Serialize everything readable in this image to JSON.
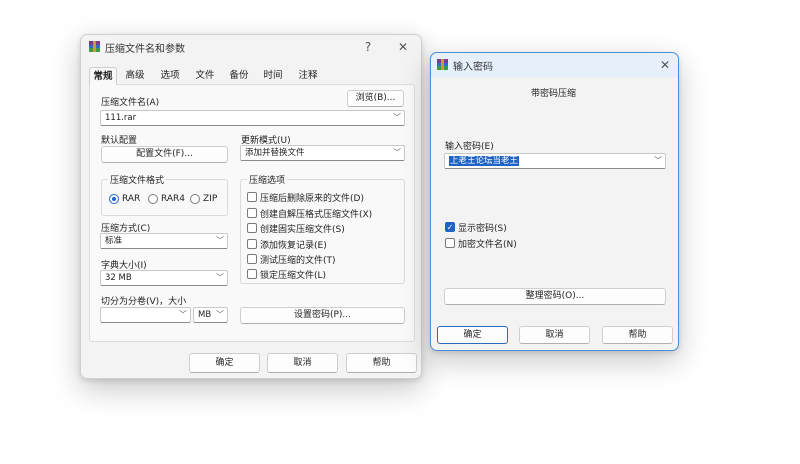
{
  "archive_dialog": {
    "title": "压缩文件名和参数",
    "help_glyph": "?",
    "close_glyph": "✕",
    "tabs": [
      "常规",
      "高级",
      "选项",
      "文件",
      "备份",
      "时间",
      "注释"
    ],
    "archive_name_label": "压缩文件名(A)",
    "browse_label": "浏览(B)...",
    "archive_name_value": "111.rar",
    "default_profile_label": "默认配置",
    "profiles_button": "配置文件(F)...",
    "update_mode_label": "更新模式(U)",
    "update_mode_value": "添加并替换文件",
    "format_group_title": "压缩文件格式",
    "formats": [
      "RAR",
      "RAR4",
      "ZIP"
    ],
    "options_group_title": "压缩选项",
    "options": [
      "压缩后删除原来的文件(D)",
      "创建自解压格式压缩文件(X)",
      "创建固实压缩文件(S)",
      "添加恢复记录(E)",
      "测试压缩的文件(T)",
      "锁定压缩文件(L)"
    ],
    "method_label": "压缩方式(C)",
    "method_value": "标准",
    "dict_label": "字典大小(I)",
    "dict_value": "32 MB",
    "split_label": "切分为分卷(V)，大小",
    "split_value": "",
    "split_unit": "MB",
    "set_password_button": "设置密码(P)...",
    "ok": "确定",
    "cancel": "取消",
    "help": "帮助"
  },
  "password_dialog": {
    "title": "输入密码",
    "close_glyph": "✕",
    "subtitle": "带密码压缩",
    "password_label": "输入密码(E)",
    "password_value": "上老王论坛当老王",
    "show_password_label": "显示密码(S)",
    "encrypt_names_label": "加密文件名(N)",
    "organize_button": "整理密码(O)...",
    "ok": "确定",
    "cancel": "取消",
    "help": "帮助"
  },
  "icons": {
    "chevron": "chevron-down-icon",
    "app": "winrar-app-icon"
  },
  "colors": {
    "accent": "#1f63c6",
    "window_bg": "#f3f3f3",
    "panel_bg": "#f9f9f9"
  }
}
